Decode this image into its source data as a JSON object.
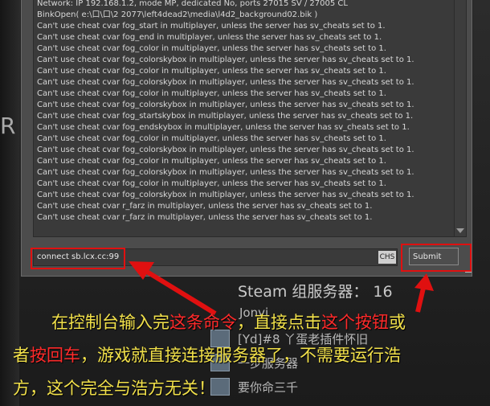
{
  "console": {
    "lines": [
      "Network: IP 192.168.1.2, mode MP, dedicated No, ports 27015 SV / 27005 CL",
      "BinkOpen( e:\\口\\口\\2 2077\\left4dead2\\media\\l4d2_background02.bik )",
      "Can't use cheat cvar fog_start in multiplayer, unless the server has sv_cheats set to 1.",
      "Can't use cheat cvar fog_end in multiplayer, unless the server has sv_cheats set to 1.",
      "Can't use cheat cvar fog_color in multiplayer, unless the server has sv_cheats set to 1.",
      "Can't use cheat cvar fog_colorskybox in multiplayer, unless the server has sv_cheats set to 1.",
      "Can't use cheat cvar fog_color in multiplayer, unless the server has sv_cheats set to 1.",
      "Can't use cheat cvar fog_colorskybox in multiplayer, unless the server has sv_cheats set to 1.",
      "Can't use cheat cvar fog_color in multiplayer, unless the server has sv_cheats set to 1.",
      "Can't use cheat cvar fog_colorskybox in multiplayer, unless the server has sv_cheats set to 1.",
      "Can't use cheat cvar fog_startskybox in multiplayer, unless the server has sv_cheats set to 1.",
      "Can't use cheat cvar fog_endskybox in multiplayer, unless the server has sv_cheats set to 1.",
      "Can't use cheat cvar fog_color in multiplayer, unless the server has sv_cheats set to 1.",
      "Can't use cheat cvar fog_colorskybox in multiplayer, unless the server has sv_cheats set to 1.",
      "Can't use cheat cvar fog_color in multiplayer, unless the server has sv_cheats set to 1.",
      "Can't use cheat cvar fog_colorskybox in multiplayer, unless the server has sv_cheats set to 1.",
      "Can't use cheat cvar fog_color in multiplayer, unless the server has sv_cheats set to 1.",
      "Can't use cheat cvar fog_colorskybox in multiplayer, unless the server has sv_cheats set to 1.",
      "Can't use cheat cvar r_farz in multiplayer, unless the server has sv_cheats set to 1.",
      "Can't use cheat cvar r_farz in multiplayer, unless the server has sv_cheats set to 1."
    ],
    "input_value": "connect sb.lcx.cc:99",
    "ime_label": "CHS",
    "submit_label": "Submit"
  },
  "background": {
    "menu_letter": "R",
    "group_header": "Steam 组服务器： 16",
    "rows": [
      "Jonvi",
      "[Yd]#8 丫蛋老插件怀旧",
      "一步服务器",
      "要你命三千"
    ]
  },
  "annotation": {
    "line1": [
      {
        "text": "在控制台输入完",
        "hl": false
      },
      {
        "text": "这条命令",
        "hl": true
      },
      {
        "text": "，直接点击",
        "hl": false
      },
      {
        "text": "这个按钮",
        "hl": true
      },
      {
        "text": "或",
        "hl": false
      }
    ],
    "line2": [
      {
        "text": "者",
        "hl": false
      },
      {
        "text": "按回车",
        "hl": true
      },
      {
        "text": "，游戏就直接连接服务器了，不需要运行浩",
        "hl": false
      }
    ],
    "line3": [
      {
        "text": "方，这个完全与浩方无关！",
        "hl": false
      }
    ]
  },
  "colors": {
    "highlight_red": "#e01010",
    "annotation_yellow": "#f2e14a",
    "console_bg": "#4c4c4c"
  }
}
